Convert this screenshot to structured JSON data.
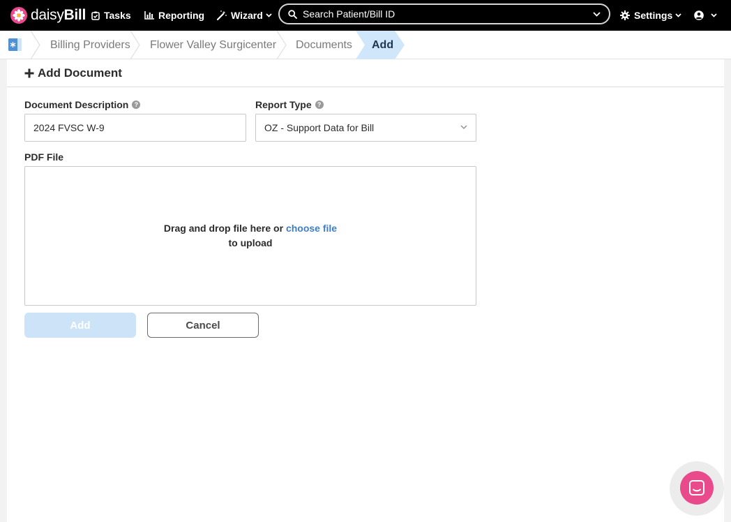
{
  "navbar": {
    "brand_prefix": "daisy",
    "brand_suffix": "Bill",
    "tasks_label": "Tasks",
    "reporting_label": "Reporting",
    "wizard_label": "Wizard",
    "search_placeholder": "Search Patient/Bill ID",
    "settings_label": "Settings"
  },
  "breadcrumb": {
    "items": [
      {
        "label": "Billing Providers"
      },
      {
        "label": "Flower Valley Surgicenter"
      },
      {
        "label": "Documents"
      }
    ],
    "active_label": "Add"
  },
  "form": {
    "title": "Add Document",
    "description_label": "Document Description",
    "description_value": "2024 FVSC W-9",
    "report_type_label": "Report Type",
    "report_type_value": "OZ - Support Data for Bill",
    "pdf_label": "PDF File",
    "dropzone_text_before": "Drag and drop file here or",
    "dropzone_link": "choose file",
    "dropzone_text_after": "to upload",
    "add_button": "Add",
    "cancel_button": "Cancel"
  },
  "colors": {
    "navbar_bg": "#000000",
    "accent_blue": "#3d7ec4",
    "active_crumb": "#cfe6fb",
    "add_button_disabled": "#cde3f8",
    "chat_pink": "#e84a8c"
  }
}
